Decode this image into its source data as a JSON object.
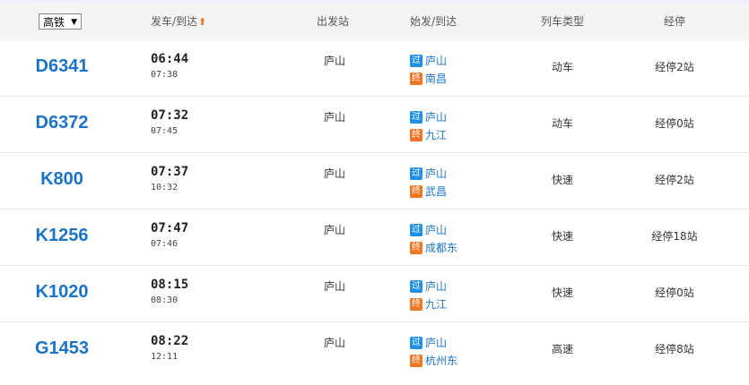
{
  "header": {
    "filter_value": "高铁",
    "filter_arrow": "▼",
    "col_time": "发车/到达",
    "sort_arrow": "⬆",
    "col_station": "出发站",
    "col_route": "始发/到达",
    "col_type": "列车类型",
    "col_stops": "经停"
  },
  "tags": {
    "pass": "过",
    "end": "终"
  },
  "rows": [
    {
      "train": "D6341",
      "dep": "06:44",
      "arr": "07:38",
      "station": "庐山",
      "from": "庐山",
      "to": "南昌",
      "type": "动车",
      "via": "经停2站"
    },
    {
      "train": "D6372",
      "dep": "07:32",
      "arr": "07:45",
      "station": "庐山",
      "from": "庐山",
      "to": "九江",
      "type": "动车",
      "via": "经停0站"
    },
    {
      "train": "K800",
      "dep": "07:37",
      "arr": "10:32",
      "station": "庐山",
      "from": "庐山",
      "to": "武昌",
      "type": "快速",
      "via": "经停2站"
    },
    {
      "train": "K1256",
      "dep": "07:47",
      "arr": "07:46",
      "station": "庐山",
      "from": "庐山",
      "to": "成都东",
      "type": "快速",
      "via": "经停18站"
    },
    {
      "train": "K1020",
      "dep": "08:15",
      "arr": "08:30",
      "station": "庐山",
      "from": "庐山",
      "to": "九江",
      "type": "快速",
      "via": "经停0站"
    },
    {
      "train": "G1453",
      "dep": "08:22",
      "arr": "12:11",
      "station": "庐山",
      "from": "庐山",
      "to": "杭州东",
      "type": "高速",
      "via": "经停8站"
    }
  ],
  "colors": {
    "link": "#1b73c8",
    "pass_tag": "#1e90e8",
    "end_tag": "#f27522"
  }
}
